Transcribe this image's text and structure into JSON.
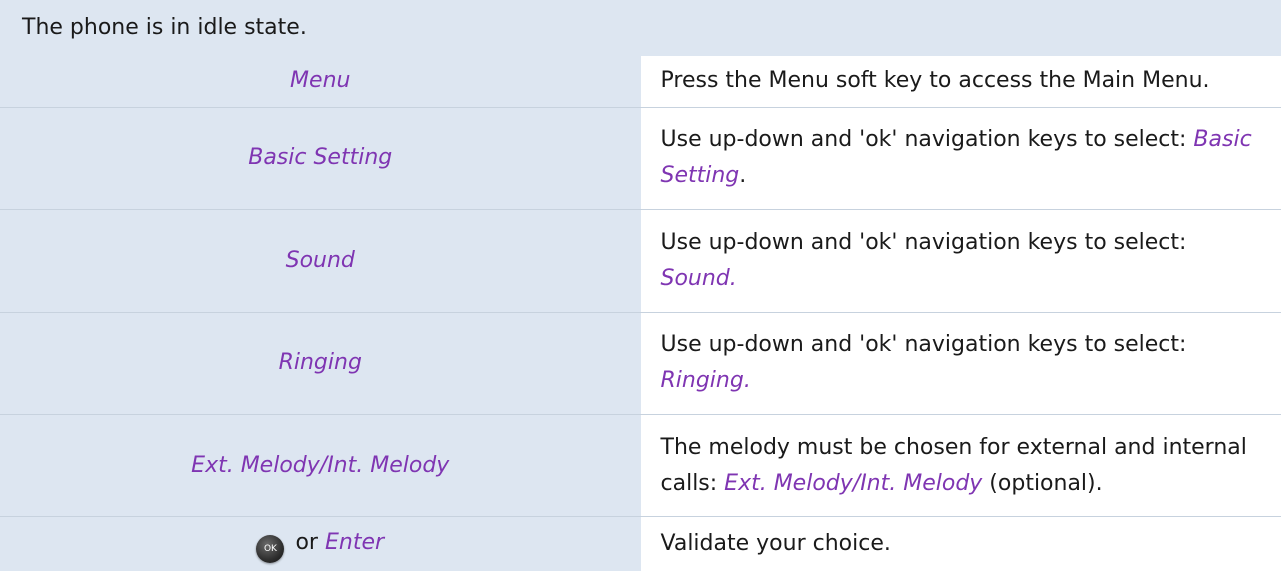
{
  "header": {
    "text": "The phone is in idle state."
  },
  "rows": [
    {
      "key": "Menu",
      "desc": "Press the Menu soft key to access the Main Menu."
    },
    {
      "key": "Basic Setting",
      "desc_prefix": "Use up-down and 'ok' navigation keys to select: ",
      "desc_kw": "Basic Setting",
      "desc_suffix": "."
    },
    {
      "key": "Sound",
      "desc_prefix": "Use up-down and 'ok' navigation keys to select: ",
      "desc_kw": "Sound."
    },
    {
      "key": "Ringing",
      "desc_prefix": "Use up-down and 'ok' navigation keys to select: ",
      "desc_kw": "Ringing."
    },
    {
      "key": "Ext. Melody/Int. Melody",
      "desc_prefix": "The melody must be chosen for external and internal calls: ",
      "desc_kw": "Ext. Melody/Int. Melody",
      "desc_suffix": " (optional)."
    },
    {
      "key_icon_label": "OK",
      "key_or": "or",
      "key": "Enter",
      "desc": "Validate your choice."
    }
  ],
  "colors": {
    "header_bg": "#dde6f1",
    "keyword": "#7f35b2",
    "divider": "#c7d2de"
  },
  "icons": {
    "ok_button": "ok-button-icon"
  }
}
